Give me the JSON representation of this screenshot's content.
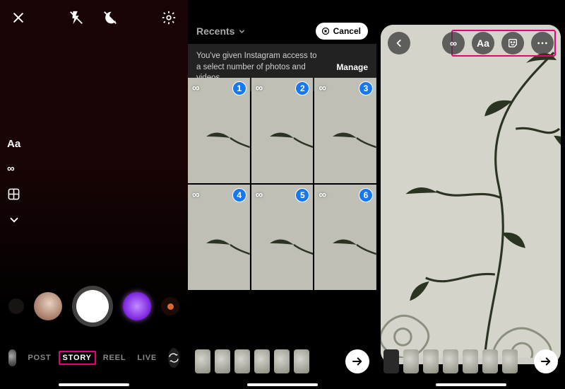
{
  "panel1": {
    "left_tools": {
      "text": "Aa",
      "infinity": "∞"
    },
    "modes": {
      "post": "POST",
      "story": "STORY",
      "reel": "REEL",
      "live": "LIVE"
    }
  },
  "panel2": {
    "recents": "Recents",
    "cancel": "Cancel",
    "access_msg": "You've given Instagram access to a select number of photos and videos.",
    "manage": "Manage",
    "cells": [
      {
        "inf": "∞",
        "num": "1"
      },
      {
        "inf": "∞",
        "num": "2"
      },
      {
        "inf": "∞",
        "num": "3"
      },
      {
        "inf": "∞",
        "num": "4"
      },
      {
        "inf": "∞",
        "num": "5"
      },
      {
        "inf": "∞",
        "num": "6"
      }
    ]
  },
  "panel3": {
    "aa": "Aa",
    "infinity": "∞"
  }
}
